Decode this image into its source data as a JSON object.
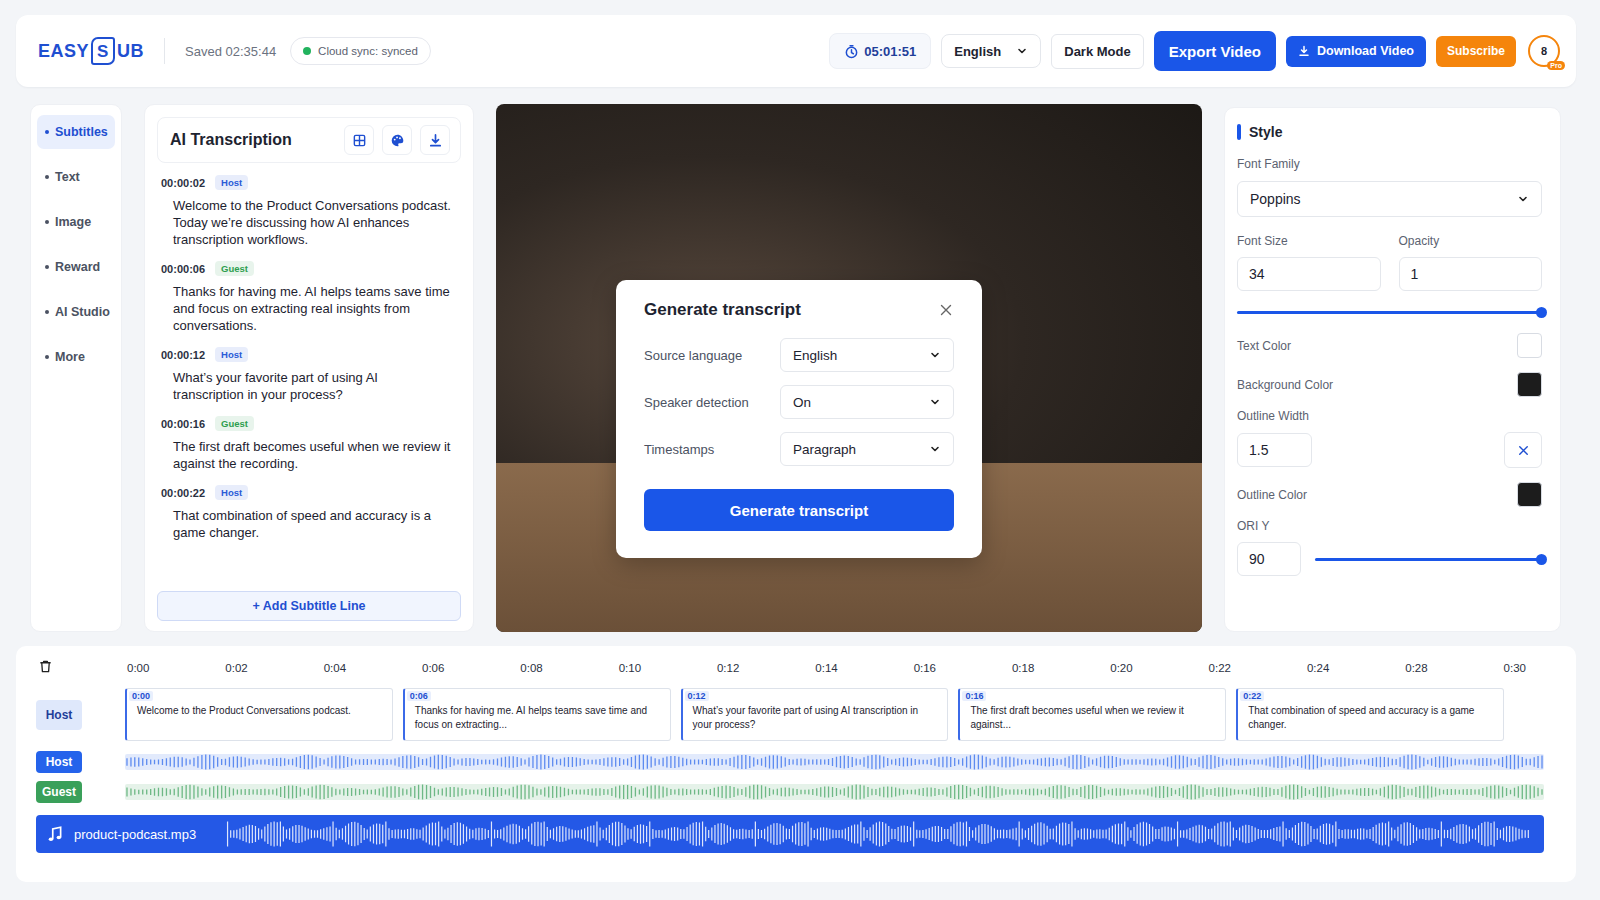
{
  "header": {
    "logo": {
      "prefix": "EASY",
      "mark": "S",
      "suffix": "UB"
    },
    "saved": "Saved 02:35:44",
    "sync": {
      "label": "Cloud sync: synced",
      "online": true
    },
    "timer": "05:01:51",
    "language": "English",
    "buttons": [
      {
        "label": "Dark Mode",
        "kind": "plain"
      },
      {
        "label": "Export Video",
        "kind": "primary"
      },
      {
        "label": "Download Video",
        "kind": "download"
      },
      {
        "label": "Subscribe",
        "kind": "accent"
      }
    ],
    "avatar": {
      "initial": "8",
      "badge": "Pro"
    }
  },
  "nav": [
    {
      "label": "Subtitles",
      "selected": true
    },
    {
      "label": "Text",
      "selected": false
    },
    {
      "label": "Image",
      "selected": false
    },
    {
      "label": "Reward",
      "selected": false
    },
    {
      "label": "AI Studio",
      "selected": false
    },
    {
      "label": "More",
      "selected": false
    }
  ],
  "transcription": {
    "title": "AI Transcription",
    "lines": [
      {
        "time": "00:00:02",
        "speaker": "Host",
        "color": "#2a5bd7",
        "text": "Welcome to the Product Conversations podcast. Today we’re discussing how AI enhances transcription workflows."
      },
      {
        "time": "00:00:06",
        "speaker": "Guest",
        "color": "#2e9e4f",
        "text": "Thanks for having me. AI helps teams save time and focus on extracting real insights from conversations."
      },
      {
        "time": "00:00:12",
        "speaker": "Host",
        "color": "#2a5bd7",
        "text": "What’s your favorite part of using AI transcription in your process?"
      },
      {
        "time": "00:00:16",
        "speaker": "Guest",
        "color": "#2e9e4f",
        "text": "The first draft becomes useful when we review it against the recording."
      },
      {
        "time": "00:00:22",
        "speaker": "Host",
        "color": "#2a5bd7",
        "text": "That combination of speed and accuracy is a game changer."
      }
    ],
    "add": "+ Add Subtitle Line"
  },
  "modal": {
    "title": "Generate transcript",
    "fields": [
      {
        "label": "Source language",
        "value": "English"
      },
      {
        "label": "Speaker detection",
        "value": "On"
      },
      {
        "label": "Timestamps",
        "value": "Paragraph"
      }
    ],
    "button": "Generate transcript"
  },
  "style": {
    "title": "Style",
    "fontFamily": {
      "label": "Font Family",
      "value": "Poppins"
    },
    "fontSize": {
      "label": "Font Size",
      "value": "34"
    },
    "opacity": {
      "label": "Opacity",
      "value": "1"
    },
    "sizeSlider": {
      "level": 1.0
    },
    "textColor": {
      "label": "Text Color",
      "swatch": "#ffffff"
    },
    "backgroundColor": {
      "label": "Background Color",
      "swatch": "#1c1c1c"
    },
    "outlineWidth": {
      "label": "Outline Width",
      "value": "1.5"
    },
    "outlineColor": {
      "label": "Outline Color",
      "swatch": "#1c1c1c"
    },
    "oriY": {
      "label": "ORI Y",
      "value": "90",
      "level": 1.0
    }
  },
  "timeline": {
    "ticks": [
      "0:00",
      "0:02",
      "0:04",
      "0:06",
      "0:08",
      "0:10",
      "0:12",
      "0:14",
      "0:16",
      "0:18",
      "0:20",
      "0:22",
      "0:24",
      "0:28",
      "0:30"
    ],
    "subtitleTrack": {
      "label": "Host",
      "clips": [
        {
          "start": "0:00",
          "text": "Welcome to the Product Conversations podcast."
        },
        {
          "start": "0:06",
          "text": "Thanks for having me. AI helps teams save time and focus on extracting..."
        },
        {
          "start": "0:12",
          "text": "What’s your favorite part of using AI transcription in your process?"
        },
        {
          "start": "0:16",
          "text": "The first draft becomes useful when we review it against..."
        },
        {
          "start": "0:22",
          "text": "That combination of speed and accuracy is a game changer."
        }
      ]
    },
    "voiceTracks": [
      {
        "label": "Host",
        "color": "#2563eb"
      },
      {
        "label": "Guest",
        "color": "#3aa05a"
      }
    ],
    "audio": {
      "file": "product-podcast.mp3"
    }
  }
}
